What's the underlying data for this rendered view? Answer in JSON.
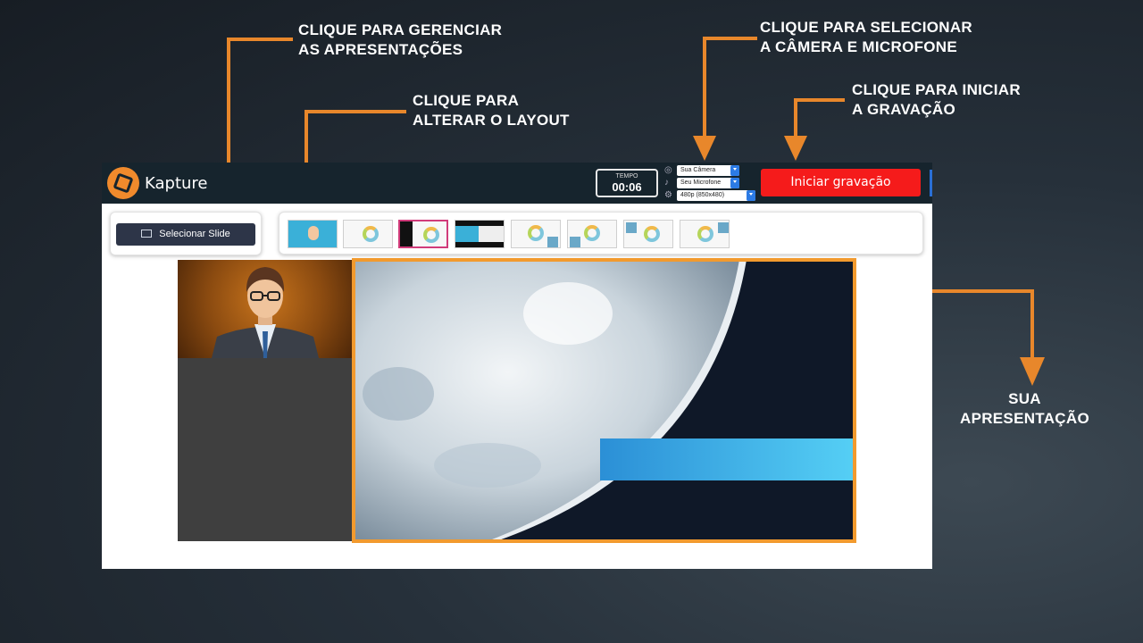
{
  "callouts": {
    "manage": [
      "CLIQUE PARA GERENCIAR",
      "AS APRESENTAÇÕES"
    ],
    "layout": [
      "CLIQUE PARA",
      "ALTERAR O LAYOUT"
    ],
    "camera": [
      "CLIQUE PARA SELECIONAR",
      "A CÂMERA E MICROFONE"
    ],
    "record": [
      "CLIQUE PARA INICIAR",
      "A GRAVAÇÃO"
    ],
    "presentation": [
      "SUA",
      "APRESENTAÇÃO"
    ]
  },
  "app": {
    "brand": "Kapture",
    "timer": {
      "label": "TEMPO",
      "value": "00:06"
    },
    "devices": {
      "camera": "Sua Câmera",
      "microphone": "Seu Microfone",
      "resolution": "480p (850x480)"
    },
    "record_button": "Iniciar gravação",
    "select_slide_button": "Selecionar Slide",
    "layouts_count": 8,
    "selected_layout_index": 2
  },
  "colors": {
    "accent_orange": "#f29a2e",
    "record_red": "#f51b1b",
    "topbar": "#16242d",
    "slide_button": "#2d3548",
    "layout_selected": "#d13b7a"
  },
  "icons": [
    "webcam-icon",
    "microphone-icon",
    "settings-icon",
    "presentation-board-icon",
    "kapture-logo-icon"
  ]
}
